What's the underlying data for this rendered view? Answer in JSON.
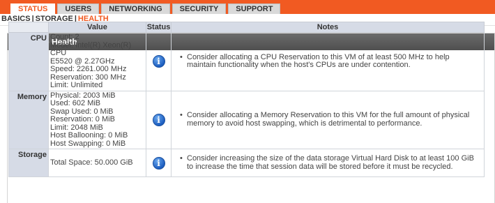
{
  "nav": {
    "tabs": [
      "STATUS",
      "USERS",
      "NETWORKING",
      "SECURITY",
      "SUPPORT"
    ],
    "active_tab": "STATUS",
    "subtabs": [
      "BASICS",
      "STORAGE",
      "HEALTH"
    ],
    "active_subtab": "HEALTH"
  },
  "panel": {
    "title": "Hardware Health"
  },
  "table": {
    "headers": [
      "Value",
      "Status",
      "Notes"
    ],
    "rows": [
      {
        "label": "CPU",
        "values": [
          "Count: 2",
          "Model: Intel(R) Xeon(R) CPU",
          "E5520 @ 2.27GHz",
          "Speed: 2261.000 MHz",
          "Reservation: 300 MHz",
          "Limit: Unlimited"
        ],
        "status_icon": "info-icon",
        "note": "Consider allocating a CPU Reservation to this VM of at least 500 MHz to help maintain functionality when the host's CPUs are under contention."
      },
      {
        "label": "Memory",
        "values": [
          "Physical: 2003 MiB",
          "Used: 602 MiB",
          "Swap Used: 0 MiB",
          "Reservation: 0 MiB",
          "Limit: 2048 MiB",
          "Host Ballooning: 0 MiB",
          "Host Swapping: 0 MiB"
        ],
        "status_icon": "info-icon",
        "note": "Consider allocating a Memory Reservation to this VM for the full amount of physical memory to avoid host swapping, which is detrimental to performance."
      },
      {
        "label": "Storage",
        "values": [
          "Total Space: 50.000 GiB"
        ],
        "status_icon": "info-icon",
        "note": "Consider increasing the size of the data storage Virtual Hard Disk to at least 100 GiB to increase the time that session data will be stored before it must be recycled."
      }
    ]
  },
  "colors": {
    "accent": "#f15a22",
    "header_bar": "#5e5e5e",
    "table_header": "#d6dbe6"
  }
}
